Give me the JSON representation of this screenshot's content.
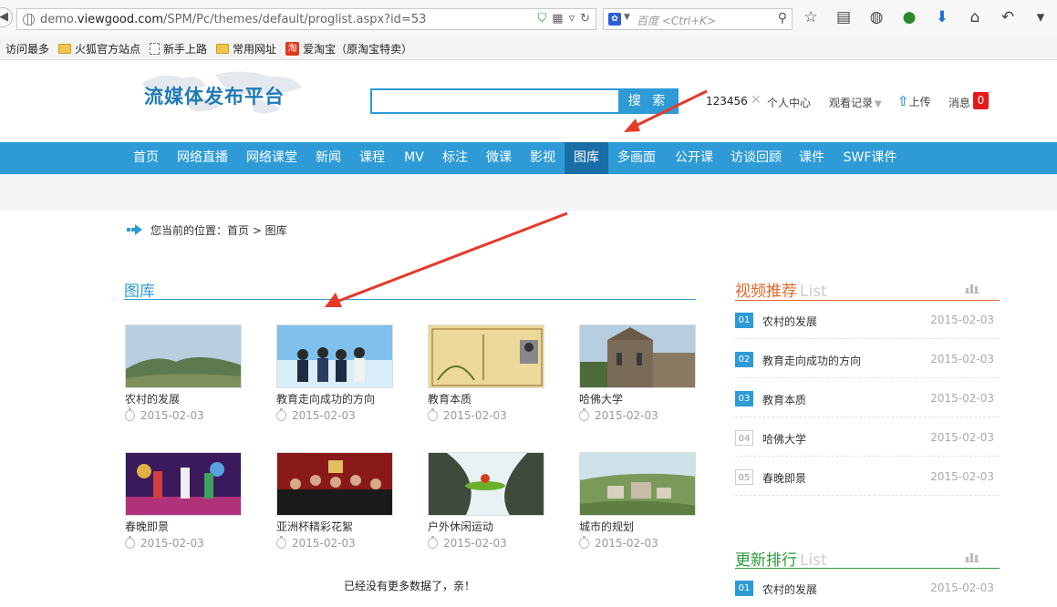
{
  "browser": {
    "url_prefix": "demo.",
    "url_domain": "viewgood.com",
    "url_path": "/SPM/Pc/themes/default/proglist.aspx?id=53",
    "search_placeholder": "百度 <Ctrl+K>",
    "bookmarks": [
      "访问最多",
      "火狐官方站点",
      "新手上路",
      "常用网址",
      "爱淘宝（原淘宝特卖）"
    ]
  },
  "header": {
    "logo": "流媒体发布平台",
    "search_button": "搜 索",
    "search_value": "",
    "user": "123456",
    "user_center": "个人中心",
    "history": "观看记录",
    "upload": "上传",
    "messages": "消息",
    "message_count": "0"
  },
  "nav": [
    "首页",
    "网络直播",
    "网络课堂",
    "新闻",
    "课程",
    "MV",
    "标注",
    "微课",
    "影视",
    "图库",
    "多画面",
    "公开课",
    "访谈回顾",
    "课件",
    "SWF课件"
  ],
  "nav_active": "图库",
  "breadcrumb": "您当前的位置：首页 > 图库",
  "gallery": {
    "title": "图库",
    "items": [
      {
        "title": "农村的发展",
        "date": "2015-02-03"
      },
      {
        "title": "教育走向成功的方向",
        "date": "2015-02-03"
      },
      {
        "title": "教育本质",
        "date": "2015-02-03"
      },
      {
        "title": "哈佛大学",
        "date": "2015-02-03"
      },
      {
        "title": "春晚即景",
        "date": "2015-02-03"
      },
      {
        "title": "亚洲杯精彩花絮",
        "date": "2015-02-03"
      },
      {
        "title": "户外休闲运动",
        "date": "2015-02-03"
      },
      {
        "title": "城市的规划",
        "date": "2015-02-03"
      }
    ],
    "no_more": "已经没有更多数据了，亲！"
  },
  "sidebar": {
    "recommend": {
      "title": "视频推荐",
      "suffix": "List",
      "accent": "#e0672a",
      "items": [
        {
          "num": "01",
          "title": "农村的发展",
          "date": "2015-02-03"
        },
        {
          "num": "02",
          "title": "教育走向成功的方向",
          "date": "2015-02-03"
        },
        {
          "num": "03",
          "title": "教育本质",
          "date": "2015-02-03"
        },
        {
          "num": "04",
          "title": "哈佛大学",
          "date": "2015-02-03"
        },
        {
          "num": "05",
          "title": "春晚即景",
          "date": "2015-02-03"
        }
      ]
    },
    "latest": {
      "title": "更新排行",
      "suffix": "List",
      "accent": "#2a9a3a",
      "items": [
        {
          "num": "01",
          "title": "农村的发展",
          "date": "2015-02-03"
        }
      ]
    }
  },
  "colors": {
    "brand": "#2e9bd6",
    "nav_active": "#1a6ea6",
    "badge": "#e51a1a",
    "annotation_arrow": "#e53a2a"
  }
}
